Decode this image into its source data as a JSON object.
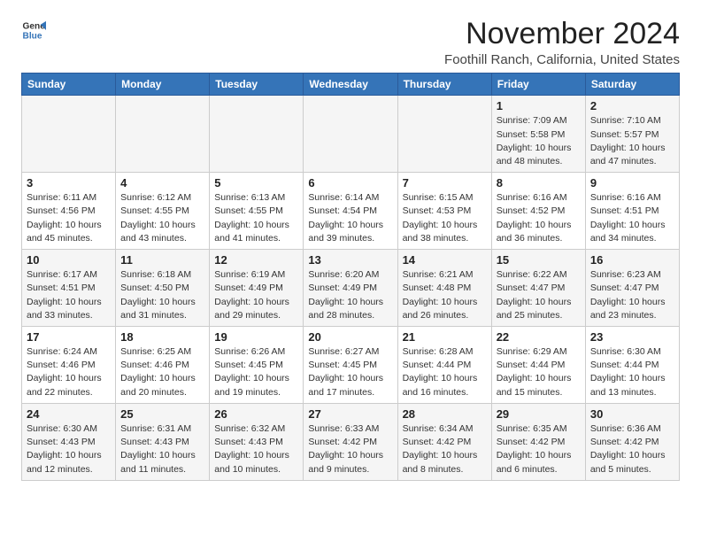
{
  "logo": {
    "line1": "General",
    "line2": "Blue"
  },
  "title": "November 2024",
  "location": "Foothill Ranch, California, United States",
  "days_of_week": [
    "Sunday",
    "Monday",
    "Tuesday",
    "Wednesday",
    "Thursday",
    "Friday",
    "Saturday"
  ],
  "weeks": [
    [
      {
        "day": "",
        "info": ""
      },
      {
        "day": "",
        "info": ""
      },
      {
        "day": "",
        "info": ""
      },
      {
        "day": "",
        "info": ""
      },
      {
        "day": "",
        "info": ""
      },
      {
        "day": "1",
        "info": "Sunrise: 7:09 AM\nSunset: 5:58 PM\nDaylight: 10 hours\nand 48 minutes."
      },
      {
        "day": "2",
        "info": "Sunrise: 7:10 AM\nSunset: 5:57 PM\nDaylight: 10 hours\nand 47 minutes."
      }
    ],
    [
      {
        "day": "3",
        "info": "Sunrise: 6:11 AM\nSunset: 4:56 PM\nDaylight: 10 hours\nand 45 minutes."
      },
      {
        "day": "4",
        "info": "Sunrise: 6:12 AM\nSunset: 4:55 PM\nDaylight: 10 hours\nand 43 minutes."
      },
      {
        "day": "5",
        "info": "Sunrise: 6:13 AM\nSunset: 4:55 PM\nDaylight: 10 hours\nand 41 minutes."
      },
      {
        "day": "6",
        "info": "Sunrise: 6:14 AM\nSunset: 4:54 PM\nDaylight: 10 hours\nand 39 minutes."
      },
      {
        "day": "7",
        "info": "Sunrise: 6:15 AM\nSunset: 4:53 PM\nDaylight: 10 hours\nand 38 minutes."
      },
      {
        "day": "8",
        "info": "Sunrise: 6:16 AM\nSunset: 4:52 PM\nDaylight: 10 hours\nand 36 minutes."
      },
      {
        "day": "9",
        "info": "Sunrise: 6:16 AM\nSunset: 4:51 PM\nDaylight: 10 hours\nand 34 minutes."
      }
    ],
    [
      {
        "day": "10",
        "info": "Sunrise: 6:17 AM\nSunset: 4:51 PM\nDaylight: 10 hours\nand 33 minutes."
      },
      {
        "day": "11",
        "info": "Sunrise: 6:18 AM\nSunset: 4:50 PM\nDaylight: 10 hours\nand 31 minutes."
      },
      {
        "day": "12",
        "info": "Sunrise: 6:19 AM\nSunset: 4:49 PM\nDaylight: 10 hours\nand 29 minutes."
      },
      {
        "day": "13",
        "info": "Sunrise: 6:20 AM\nSunset: 4:49 PM\nDaylight: 10 hours\nand 28 minutes."
      },
      {
        "day": "14",
        "info": "Sunrise: 6:21 AM\nSunset: 4:48 PM\nDaylight: 10 hours\nand 26 minutes."
      },
      {
        "day": "15",
        "info": "Sunrise: 6:22 AM\nSunset: 4:47 PM\nDaylight: 10 hours\nand 25 minutes."
      },
      {
        "day": "16",
        "info": "Sunrise: 6:23 AM\nSunset: 4:47 PM\nDaylight: 10 hours\nand 23 minutes."
      }
    ],
    [
      {
        "day": "17",
        "info": "Sunrise: 6:24 AM\nSunset: 4:46 PM\nDaylight: 10 hours\nand 22 minutes."
      },
      {
        "day": "18",
        "info": "Sunrise: 6:25 AM\nSunset: 4:46 PM\nDaylight: 10 hours\nand 20 minutes."
      },
      {
        "day": "19",
        "info": "Sunrise: 6:26 AM\nSunset: 4:45 PM\nDaylight: 10 hours\nand 19 minutes."
      },
      {
        "day": "20",
        "info": "Sunrise: 6:27 AM\nSunset: 4:45 PM\nDaylight: 10 hours\nand 17 minutes."
      },
      {
        "day": "21",
        "info": "Sunrise: 6:28 AM\nSunset: 4:44 PM\nDaylight: 10 hours\nand 16 minutes."
      },
      {
        "day": "22",
        "info": "Sunrise: 6:29 AM\nSunset: 4:44 PM\nDaylight: 10 hours\nand 15 minutes."
      },
      {
        "day": "23",
        "info": "Sunrise: 6:30 AM\nSunset: 4:44 PM\nDaylight: 10 hours\nand 13 minutes."
      }
    ],
    [
      {
        "day": "24",
        "info": "Sunrise: 6:30 AM\nSunset: 4:43 PM\nDaylight: 10 hours\nand 12 minutes."
      },
      {
        "day": "25",
        "info": "Sunrise: 6:31 AM\nSunset: 4:43 PM\nDaylight: 10 hours\nand 11 minutes."
      },
      {
        "day": "26",
        "info": "Sunrise: 6:32 AM\nSunset: 4:43 PM\nDaylight: 10 hours\nand 10 minutes."
      },
      {
        "day": "27",
        "info": "Sunrise: 6:33 AM\nSunset: 4:42 PM\nDaylight: 10 hours\nand 9 minutes."
      },
      {
        "day": "28",
        "info": "Sunrise: 6:34 AM\nSunset: 4:42 PM\nDaylight: 10 hours\nand 8 minutes."
      },
      {
        "day": "29",
        "info": "Sunrise: 6:35 AM\nSunset: 4:42 PM\nDaylight: 10 hours\nand 6 minutes."
      },
      {
        "day": "30",
        "info": "Sunrise: 6:36 AM\nSunset: 4:42 PM\nDaylight: 10 hours\nand 5 minutes."
      }
    ]
  ]
}
